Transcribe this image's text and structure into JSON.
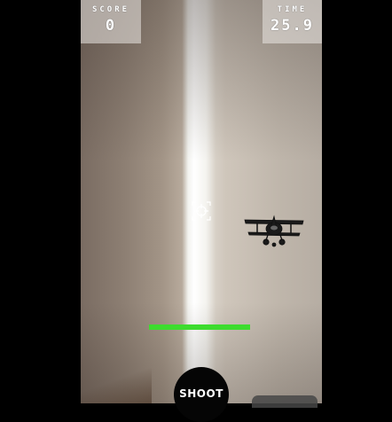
{
  "hud": {
    "score_label": "SCORE",
    "score_value": "0",
    "time_label": "TIME",
    "time_value": "25.9"
  },
  "player": {
    "health_fraction": 1.0
  },
  "controls": {
    "shoot_label": "SHOOT"
  },
  "colors": {
    "health_bar": "#3ddc2e",
    "hud_text": "#ffffff",
    "shoot_button_bg": "#050505"
  },
  "icons": {
    "crosshair": "crosshair-icon",
    "enemy": "biplane-icon"
  }
}
